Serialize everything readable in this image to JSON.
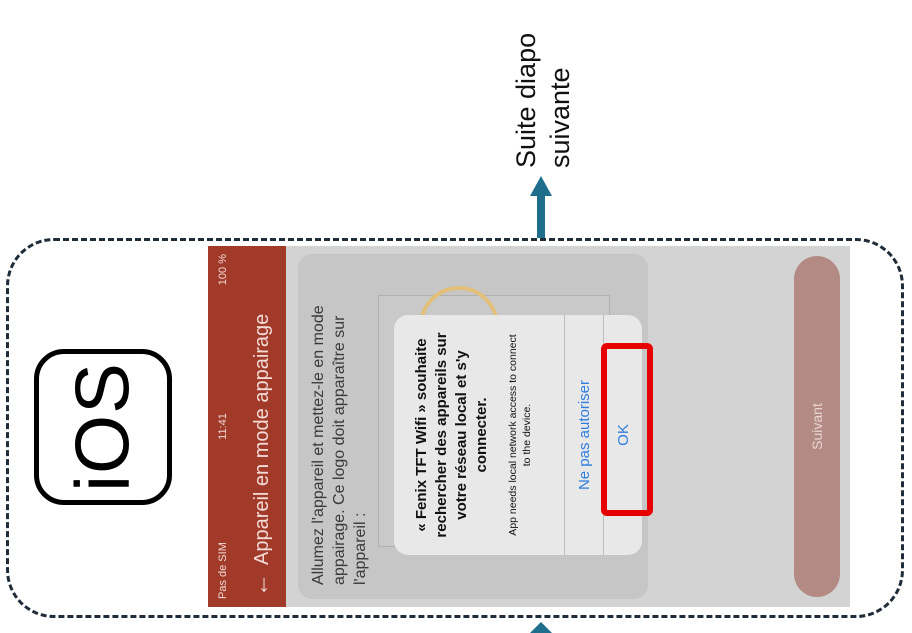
{
  "caption": {
    "text": "Suite diapo\nsuivante"
  },
  "badge": {
    "text": "iOS"
  },
  "statusbar": {
    "carrier": "Pas de SIM",
    "time": "11:41",
    "battery": "100 %"
  },
  "titlebar": {
    "back_icon": "←",
    "title": "Appareil en mode appairage"
  },
  "instructions": "Allumez l'appareil et mettez-le en mode appairage. Ce logo doit apparaître sur l'appareil :",
  "dialog": {
    "title": "« Fenix TFT Wifi » souhaite rechercher des appareils sur votre réseau local et s'y connecter.",
    "message": "App needs local network access to connect to the device.",
    "deny_label": "Ne pas autoriser",
    "ok_label": "OK"
  },
  "next_label": "Suivant",
  "colors": {
    "accent": "#a23a2a",
    "highlight": "#e60000",
    "link": "#2f7de1",
    "arrow": "#1f6e8c"
  }
}
